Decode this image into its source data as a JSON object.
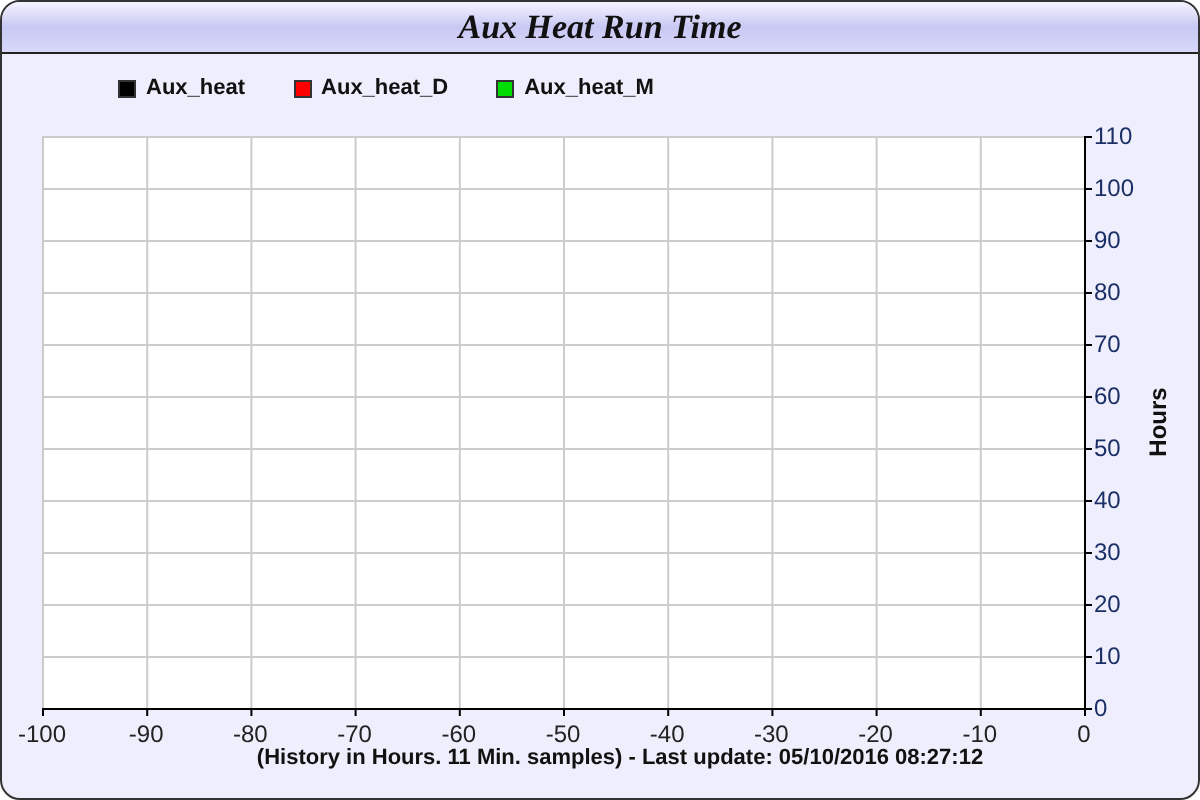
{
  "window": {
    "title": "Aux Heat Run Time"
  },
  "chart": {
    "chart_data": {
      "type": "line",
      "ylabel": "Hours",
      "xlabel": "(History in Hours. 11 Min. samples) - Last update: 05/10/2016 08:27:12",
      "grid": true,
      "categories": [
        "-100",
        "-90",
        "-80",
        "-70",
        "-60",
        "-50",
        "-40",
        "-30",
        "-20",
        "-10",
        "0"
      ],
      "series": [
        {
          "name": "Aux_heat",
          "color": "#000000",
          "values": [
            null,
            null,
            null,
            null,
            null,
            null,
            null,
            null,
            null,
            null,
            null
          ]
        },
        {
          "name": "Aux_heat_D",
          "color": "#ff0000",
          "values": [
            null,
            null,
            null,
            null,
            null,
            null,
            null,
            null,
            null,
            null,
            null
          ]
        },
        {
          "name": "Aux_heat_M",
          "color": "#00dd00",
          "values": [
            null,
            null,
            null,
            null,
            null,
            null,
            null,
            null,
            null,
            null,
            null
          ]
        }
      ],
      "ylim": [
        0,
        110
      ],
      "yticks": [
        0,
        10,
        20,
        30,
        40,
        50,
        60,
        70,
        80,
        90,
        100,
        110
      ]
    }
  }
}
